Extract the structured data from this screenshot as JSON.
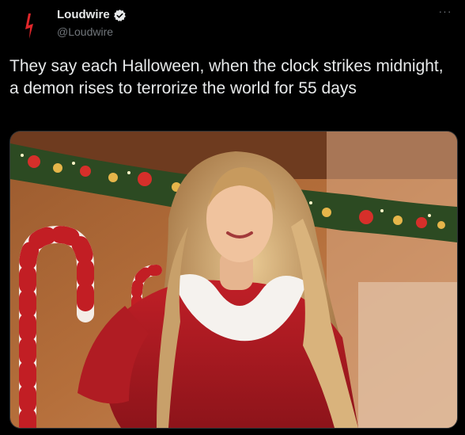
{
  "author": {
    "display_name": "Loudwire",
    "handle": "@Loudwire",
    "verified": true,
    "avatar_icon": "lightning-bolt-icon",
    "avatar_color": "#e0262a"
  },
  "menu": {
    "icon": "more-options-icon",
    "label": "···"
  },
  "tweet": {
    "text": "They say each Halloween, when the clock strikes midnight, a demon rises to terrorize the world for 55 days"
  },
  "colors": {
    "background": "#000000",
    "text": "#e7e9ea",
    "muted": "#71767b",
    "verified_badge": "#e7e9ea"
  }
}
